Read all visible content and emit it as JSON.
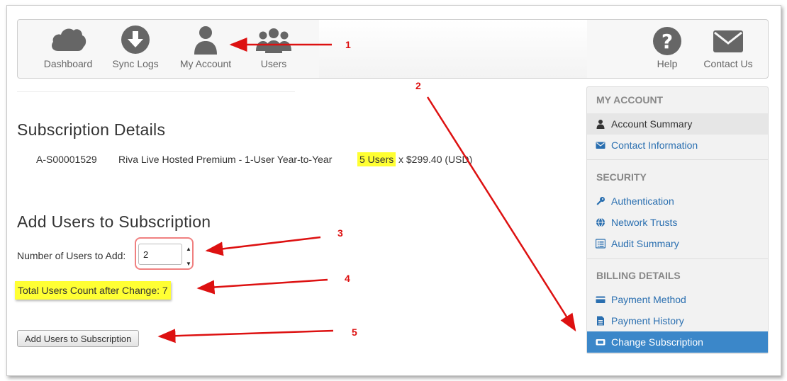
{
  "nav": {
    "left": [
      {
        "label": "Dashboard",
        "icon": "cloud-icon"
      },
      {
        "label": "Sync Logs",
        "icon": "download-circle-icon"
      },
      {
        "label": "My Account",
        "icon": "user-icon"
      },
      {
        "label": "Users",
        "icon": "users-icon"
      }
    ],
    "right": [
      {
        "label": "Help",
        "icon": "question-circle-icon"
      },
      {
        "label": "Contact Us",
        "icon": "envelope-icon"
      }
    ]
  },
  "subscription": {
    "heading": "Subscription Details",
    "id": "A-S00001529",
    "plan": "Riva Live Hosted Premium - 1-User Year-to-Year",
    "users": "5 Users",
    "price": "x $299.40 (USD)"
  },
  "add_users": {
    "heading": "Add Users to Subscription",
    "qty_label": "Number of Users to Add:",
    "qty_value": "2",
    "total_text": "Total Users Count after Change: 7",
    "button_label": "Add Users to Subscription"
  },
  "sidebar": {
    "sections": [
      {
        "title": "MY ACCOUNT",
        "items": [
          "Account Summary",
          "Contact Information"
        ]
      },
      {
        "title": "SECURITY",
        "items": [
          "Authentication",
          "Network Trusts",
          "Audit Summary"
        ]
      },
      {
        "title": "BILLING DETAILS",
        "items": [
          "Payment Method",
          "Payment History",
          "Change Subscription"
        ]
      }
    ],
    "selected_item": "Change Subscription"
  },
  "annotations": [
    "1",
    "2",
    "3",
    "4",
    "5"
  ],
  "colors": {
    "link": "#2a6fb0",
    "selected_bg": "#3b87c9",
    "highlight": "#ffff33",
    "annotation_red": "#dd1111",
    "icon_gray": "#666666"
  }
}
